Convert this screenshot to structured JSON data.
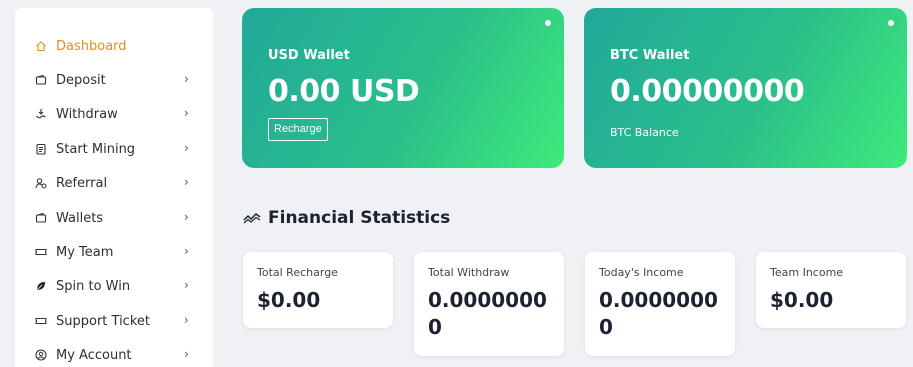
{
  "sidebar": {
    "items": [
      {
        "label": "Dashboard",
        "icon": "home-icon",
        "active": true
      },
      {
        "label": "Deposit",
        "icon": "wallet-icon"
      },
      {
        "label": "Withdraw",
        "icon": "withdraw-icon"
      },
      {
        "label": "Start Mining",
        "icon": "clipboard-icon"
      },
      {
        "label": "Referral",
        "icon": "users-icon"
      },
      {
        "label": "Wallets",
        "icon": "wallet-icon"
      },
      {
        "label": "My Team",
        "icon": "ticket-icon"
      },
      {
        "label": "Spin to Win",
        "icon": "leaf-icon"
      },
      {
        "label": "Support Ticket",
        "icon": "ticket-icon"
      },
      {
        "label": "My Account",
        "icon": "user-circle-icon"
      }
    ],
    "chevron": "›"
  },
  "usd_wallet": {
    "title": "USD Wallet",
    "amount": "0.00 USD",
    "button_label": "Recharge"
  },
  "btc_wallet": {
    "title": "BTC Wallet",
    "amount": "0.00000000",
    "subtitle": "BTC Balance"
  },
  "financial": {
    "title": "Financial Statistics",
    "icon": "chart-line-icon",
    "stats": [
      {
        "label": "Total Recharge",
        "value": "$0.00"
      },
      {
        "label": "Total Withdraw",
        "value_line1": "0.0000000",
        "value_line2": "0"
      },
      {
        "label": "Today's Income",
        "value_line1": "0.0000000",
        "value_line2": "0"
      },
      {
        "label": "Team Income",
        "value": "$0.00"
      }
    ]
  },
  "colors": {
    "accent": "#e88d14",
    "gradient_start": "#21a99a",
    "gradient_end": "#3deb7a",
    "background": "#f0f1f4"
  }
}
